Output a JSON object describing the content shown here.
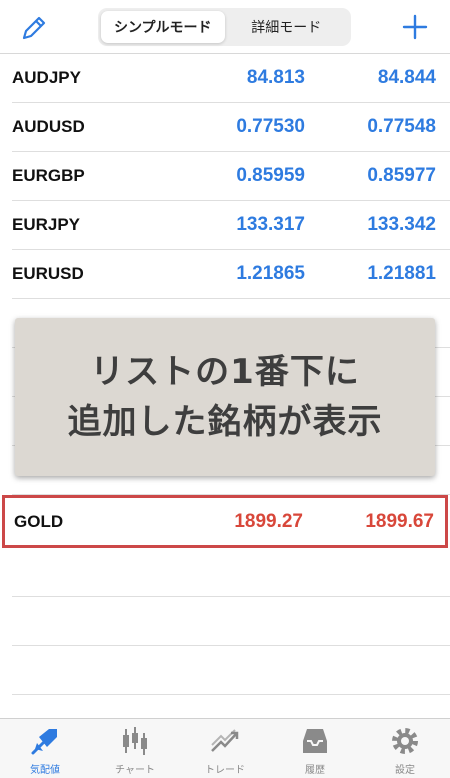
{
  "header": {
    "segments": [
      "シンプルモード",
      "詳細モード"
    ],
    "active_segment": "シンプルモード"
  },
  "quotes": [
    {
      "symbol": "AUDJPY",
      "bid": "84.813",
      "ask": "84.844"
    },
    {
      "symbol": "AUDUSD",
      "bid": "0.77530",
      "ask": "0.77548"
    },
    {
      "symbol": "EURGBP",
      "bid": "0.85959",
      "ask": "0.85977"
    },
    {
      "symbol": "EURJPY",
      "bid": "133.317",
      "ask": "133.342"
    },
    {
      "symbol": "EURUSD",
      "bid": "1.21865",
      "ask": "1.21881"
    }
  ],
  "highlight_quote": {
    "symbol": "GOLD",
    "bid": "1899.27",
    "ask": "1899.67"
  },
  "overlay": {
    "line1": "リストの1番下に",
    "line2": "追加した銘柄が表示"
  },
  "tabbar": {
    "items": [
      {
        "label": "気配値",
        "icon": "quotes-icon",
        "active": true
      },
      {
        "label": "チャート",
        "icon": "chart-icon",
        "active": false
      },
      {
        "label": "トレード",
        "icon": "trade-icon",
        "active": false
      },
      {
        "label": "履歴",
        "icon": "history-icon",
        "active": false
      },
      {
        "label": "設定",
        "icon": "settings-icon",
        "active": false
      }
    ]
  },
  "colors": {
    "accent": "#2e7be0",
    "down": "#d8473a",
    "highlight_border": "#cc4848"
  }
}
